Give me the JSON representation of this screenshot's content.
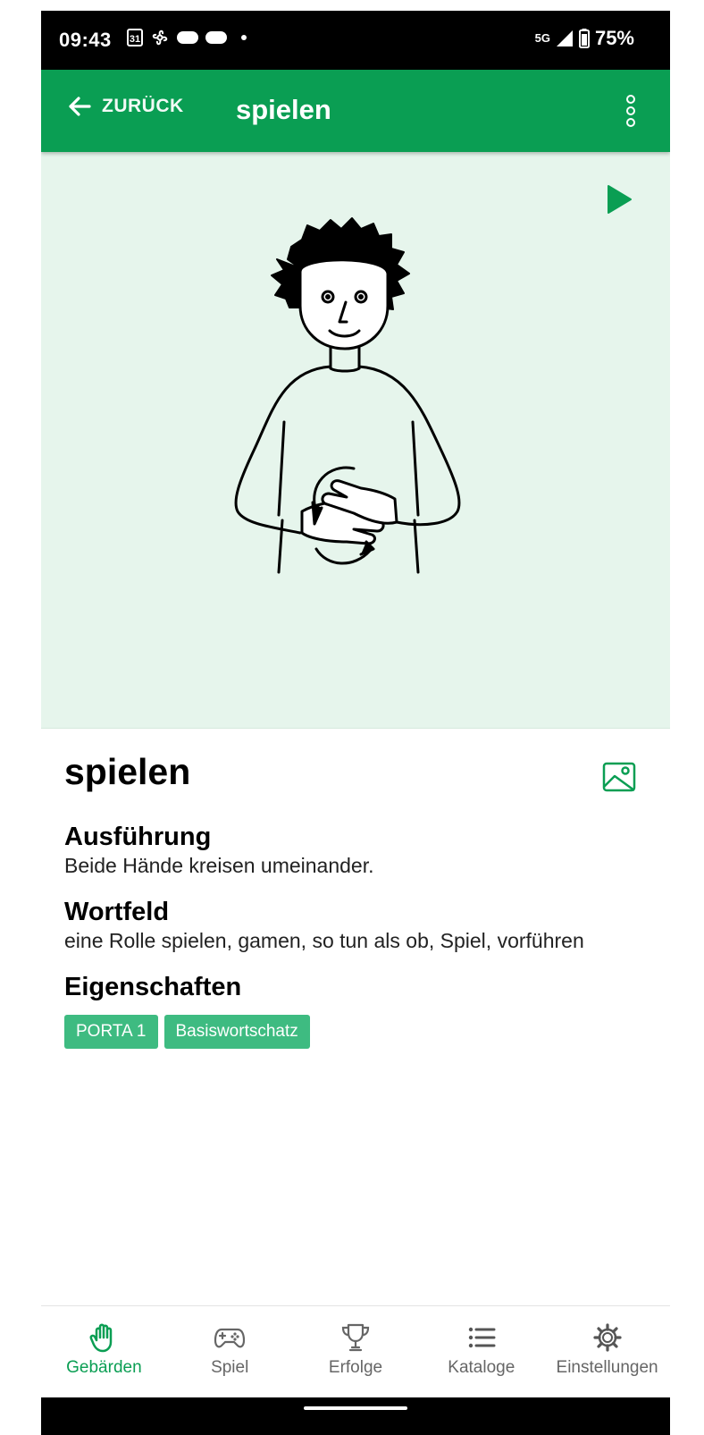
{
  "status_bar": {
    "time": "09:43",
    "calendar_day": "31",
    "network": "5G",
    "battery": "75%"
  },
  "app_bar": {
    "back_label": "ZURÜCK",
    "title": "spielen"
  },
  "detail": {
    "word": "spielen",
    "sections": [
      {
        "heading": "Ausführung",
        "text": "Beide Hände kreisen umeinander."
      },
      {
        "heading": "Wortfeld",
        "text": "eine Rolle spielen, gamen, so tun als ob, Spiel, vorführen"
      }
    ],
    "properties_heading": "Eigenschaften",
    "tags": [
      "PORTA 1",
      "Basiswortschatz"
    ]
  },
  "bottom_nav": {
    "items": [
      {
        "label": "Gebärden",
        "icon": "hand-icon",
        "active": true
      },
      {
        "label": "Spiel",
        "icon": "gamepad-icon",
        "active": false
      },
      {
        "label": "Erfolge",
        "icon": "trophy-icon",
        "active": false
      },
      {
        "label": "Kataloge",
        "icon": "list-icon",
        "active": false
      },
      {
        "label": "Einstellungen",
        "icon": "gear-icon",
        "active": false
      }
    ]
  },
  "colors": {
    "primary": "#0a9e53",
    "illustration_bg": "#e6f5ec",
    "tag_bg": "#3ebb81"
  }
}
